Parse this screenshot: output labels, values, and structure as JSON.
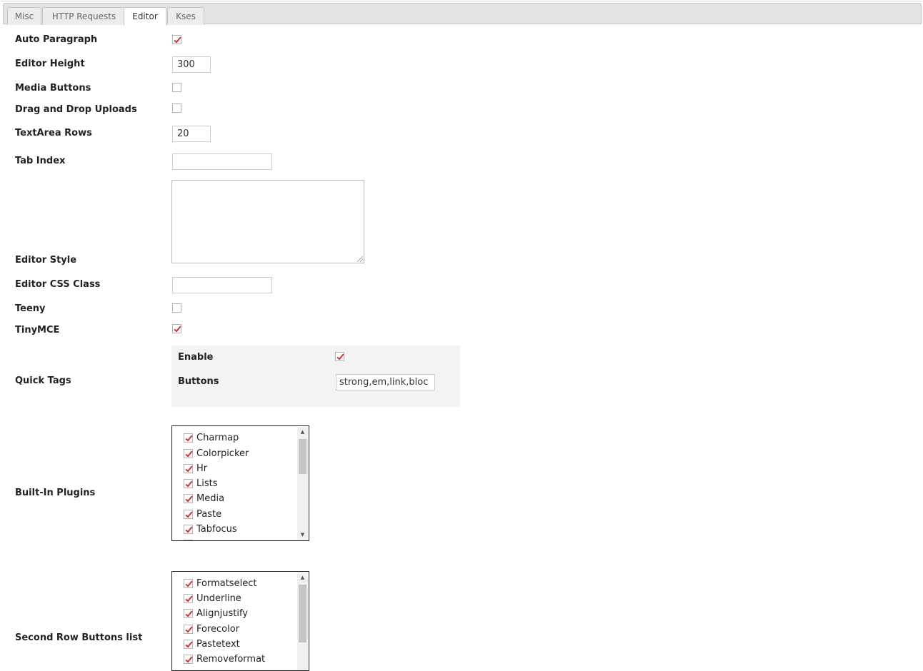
{
  "tabs": [
    {
      "label": "Misc",
      "active": false
    },
    {
      "label": "HTTP Requests",
      "active": false
    },
    {
      "label": "Editor",
      "active": true
    },
    {
      "label": "Kses",
      "active": false
    }
  ],
  "fields": {
    "auto_paragraph": {
      "label": "Auto Paragraph",
      "checked": true
    },
    "editor_height": {
      "label": "Editor Height",
      "value": "300"
    },
    "media_buttons": {
      "label": "Media Buttons",
      "checked": false
    },
    "drag_drop": {
      "label": "Drag and Drop Uploads",
      "checked": false
    },
    "textarea_rows": {
      "label": "TextArea Rows",
      "value": "20"
    },
    "tab_index": {
      "label": "Tab Index",
      "value": ""
    },
    "editor_style": {
      "label": "Editor Style",
      "value": ""
    },
    "editor_css_class": {
      "label": "Editor CSS Class",
      "value": ""
    },
    "teeny": {
      "label": "Teeny",
      "checked": false
    },
    "tinymce": {
      "label": "TinyMCE",
      "checked": true
    }
  },
  "quick_tags": {
    "label": "Quick Tags",
    "enable": {
      "label": "Enable",
      "checked": true
    },
    "buttons": {
      "label": "Buttons",
      "value": "strong,em,link,bloc"
    }
  },
  "built_in_plugins": {
    "label": "Built-In Plugins",
    "items": [
      "Charmap",
      "Colorpicker",
      "Hr",
      "Lists",
      "Media",
      "Paste",
      "Tabfocus"
    ]
  },
  "second_row_buttons": {
    "label": "Second Row Buttons list",
    "items": [
      "Formatselect",
      "Underline",
      "Alignjustify",
      "Forecolor",
      "Pastetext",
      "Removeformat"
    ]
  },
  "colors": {
    "check": "#cc3333",
    "panel_bg": "#f3f3f3",
    "tabbar_bg": "#e3e3e3"
  }
}
